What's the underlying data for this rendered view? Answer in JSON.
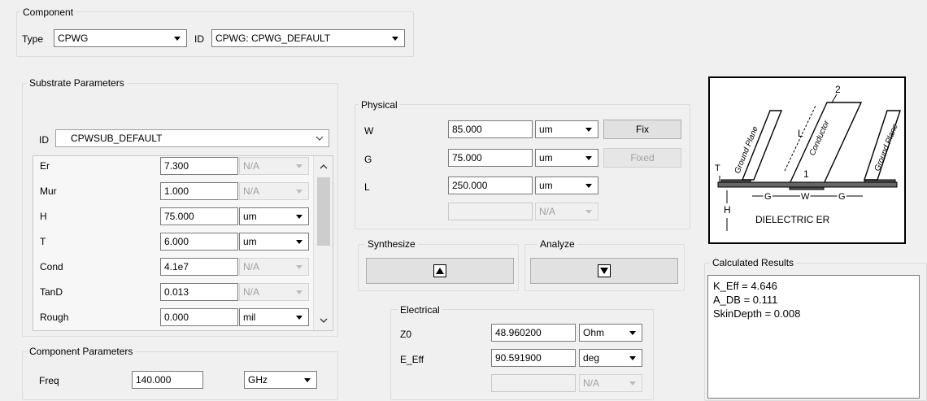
{
  "component": {
    "title": "Component",
    "type_label": "Type",
    "type_value": "CPWG",
    "id_label": "ID",
    "id_value": "CPWG: CPWG_DEFAULT"
  },
  "substrate": {
    "title": "Substrate Parameters",
    "id_label": "ID",
    "id_value": "CPWSUB_DEFAULT",
    "rows": [
      {
        "name": "Er",
        "value": "7.300",
        "unit": "N/A",
        "unit_disabled": true
      },
      {
        "name": "Mur",
        "value": "1.000",
        "unit": "N/A",
        "unit_disabled": true
      },
      {
        "name": "H",
        "value": "75.000",
        "unit": "um",
        "unit_disabled": false
      },
      {
        "name": "T",
        "value": "6.000",
        "unit": "um",
        "unit_disabled": false
      },
      {
        "name": "Cond",
        "value": "4.1e7",
        "unit": "N/A",
        "unit_disabled": true
      },
      {
        "name": "TanD",
        "value": "0.013",
        "unit": "N/A",
        "unit_disabled": true
      },
      {
        "name": "Rough",
        "value": "0.000",
        "unit": "mil",
        "unit_disabled": false
      }
    ]
  },
  "component_params": {
    "title": "Component Parameters",
    "freq_label": "Freq",
    "freq_value": "140.000",
    "freq_unit": "GHz"
  },
  "physical": {
    "title": "Physical",
    "rows": [
      {
        "name": "W",
        "value": "85.000",
        "unit": "um",
        "button": "Fix",
        "button_disabled": false
      },
      {
        "name": "G",
        "value": "75.000",
        "unit": "um",
        "button": "Fixed",
        "button_disabled": true
      },
      {
        "name": "L",
        "value": "250.000",
        "unit": "um",
        "button": "",
        "button_disabled": false
      }
    ],
    "extra_unit": "N/A"
  },
  "synthesize": {
    "title": "Synthesize",
    "icon": "triangle-up-icon"
  },
  "analyze": {
    "title": "Analyze",
    "icon": "triangle-down-icon"
  },
  "electrical": {
    "title": "Electrical",
    "rows": [
      {
        "name": "Z0",
        "value": "48.960200",
        "unit": "Ohm"
      },
      {
        "name": "E_Eff",
        "value": "90.591900",
        "unit": "deg"
      }
    ],
    "extra_unit": "N/A"
  },
  "diagram": {
    "top_label": "2",
    "l_label": "L",
    "conductor_label": "Conductor",
    "ground_left": "Ground Plane",
    "ground_right": "Ground Plane",
    "one_label": "1",
    "t_label": "T",
    "h_label": "H",
    "g_label": "G",
    "w_label": "W",
    "dielectric": "DIELECTRIC ER"
  },
  "results": {
    "title": "Calculated Results",
    "lines": [
      "K_Eff = 4.646",
      "A_DB = 0.111",
      "SkinDepth = 0.008"
    ]
  }
}
